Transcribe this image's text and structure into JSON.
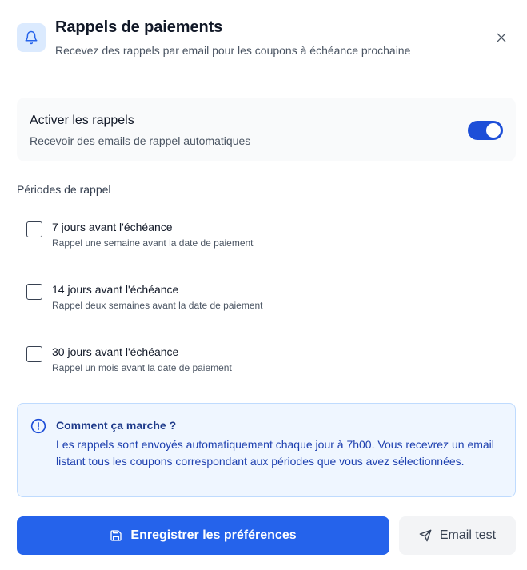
{
  "header": {
    "title": "Rappels de paiements",
    "subtitle": "Recevez des rappels par email pour les coupons à échéance prochaine"
  },
  "toggle": {
    "title": "Activer les rappels",
    "description": "Recevoir des emails de rappel automatiques",
    "enabled": true
  },
  "periods_section": {
    "label": "Périodes de rappel",
    "items": [
      {
        "title": "7 jours avant l'échéance",
        "description": "Rappel une semaine avant la date de paiement",
        "checked": false
      },
      {
        "title": "14 jours avant l'échéance",
        "description": "Rappel deux semaines avant la date de paiement",
        "checked": false
      },
      {
        "title": "30 jours avant l'échéance",
        "description": "Rappel un mois avant la date de paiement",
        "checked": false
      }
    ]
  },
  "info": {
    "title": "Comment ça marche ?",
    "text": "Les rappels sont envoyés automatiquement chaque jour à 7h00. Vous recevrez un email listant tous les coupons correspondant aux périodes que vous avez sélectionnées."
  },
  "actions": {
    "save_label": "Enregistrer les préférences",
    "test_label": "Email test"
  },
  "icons": {
    "header": "bell-icon",
    "close": "close-icon",
    "info": "info-icon",
    "save": "save-icon",
    "test": "send-icon"
  },
  "colors": {
    "primary": "#2563eb",
    "switch_on": "#1d4ed8",
    "info_bg": "#eff6ff",
    "info_text": "#1e40af"
  }
}
